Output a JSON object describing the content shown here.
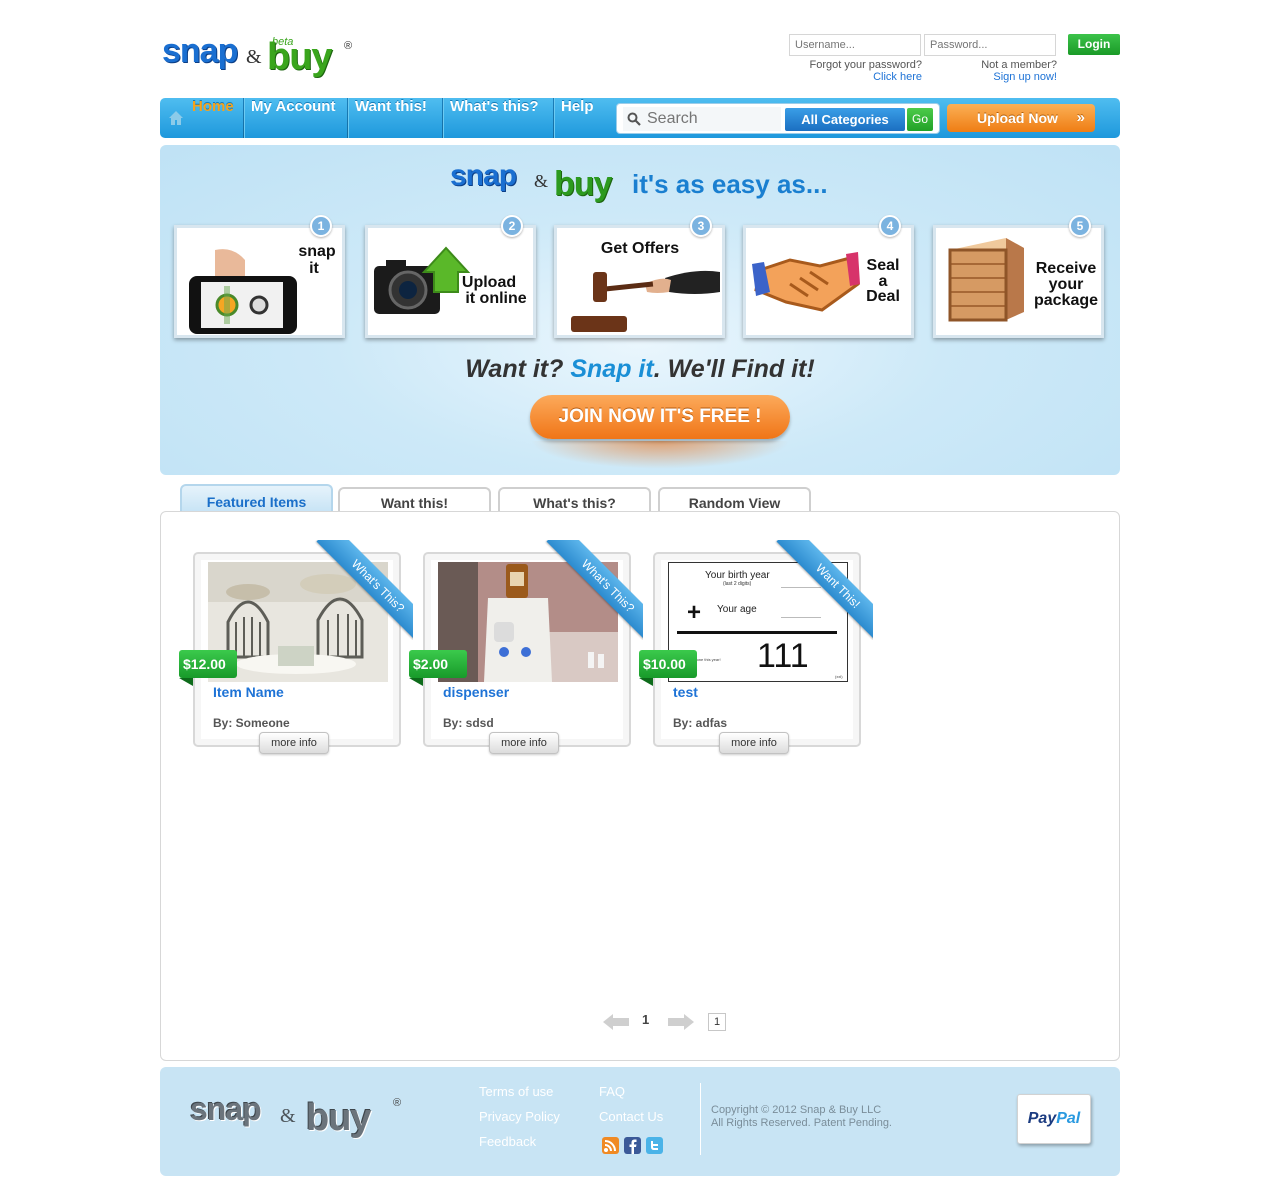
{
  "brand": {
    "snap": "snap",
    "amp": "&",
    "buy": "buy",
    "beta": "beta",
    "reg": "®"
  },
  "login": {
    "username_placeholder": "Username...",
    "password_placeholder": "Password...",
    "login_label": "Login",
    "forgot_text": "Forgot your password?",
    "forgot_link": "Click here",
    "member_text": "Not a member?",
    "member_link": "Sign up now!"
  },
  "nav": {
    "items": [
      {
        "label": "Home",
        "active": true
      },
      {
        "label": "My Account"
      },
      {
        "label": "Want this!"
      },
      {
        "label": "What's this?"
      },
      {
        "label": "Help"
      }
    ],
    "search_placeholder": "Search",
    "category_label": "All Categories",
    "go_label": "Go",
    "upload_label": "Upload Now",
    "upload_arrows": "»"
  },
  "banner": {
    "title_tag": "it's as easy as...",
    "steps": [
      {
        "num": "1",
        "label_line1": "snap",
        "label_line2": "it"
      },
      {
        "num": "2",
        "label_line1": "Upload",
        "label_line2": "it online"
      },
      {
        "num": "3",
        "label_line1": "Get Offers"
      },
      {
        "num": "4",
        "label_line1": "Seal",
        "label_line2": "a",
        "label_line3": "Deal"
      },
      {
        "num": "5",
        "label_line1": "Receive",
        "label_line2": "your",
        "label_line3": "package"
      }
    ],
    "tagline_a": "Want it? ",
    "tagline_b": "Snap it",
    "tagline_c": ". We'll Find it!",
    "join_label": "JOIN NOW IT'S FREE !"
  },
  "tabs": [
    {
      "label": "Featured Items",
      "active": true
    },
    {
      "label": "Want this!"
    },
    {
      "label": "What's this?"
    },
    {
      "label": "Random View"
    }
  ],
  "items": [
    {
      "price": "$12.00",
      "name": "Item Name",
      "by": "By: Someone",
      "ribbon": "What's This?",
      "more": "more info"
    },
    {
      "price": "$2.00",
      "name": "dispenser",
      "by": "By: sdsd",
      "ribbon": "What's This?",
      "more": "more info"
    },
    {
      "price": "$10.00",
      "name": "test",
      "by": "By: adfas",
      "ribbon": "Want This!",
      "more": "more info"
    }
  ],
  "item3_image": {
    "line1": "Your birth year",
    "line1_sub": "(last 2 digits)",
    "line2": "Your age",
    "plus": "+",
    "result": "111",
    "foot": "...me for everyone this year!",
    "foot_right": "(xxl)"
  },
  "pager": {
    "current": "1",
    "input_value": "1"
  },
  "footer": {
    "links_col1": [
      "Terms of use",
      "Privacy Policy",
      "Feedback"
    ],
    "links_col2": [
      "FAQ",
      "Contact Us"
    ],
    "copyright_line1": "Copyright © 2012 Snap & Buy LLC",
    "copyright_line2": "All Rights Reserved. Patent Pending.",
    "paypal_pay": "Pay",
    "paypal_pal": "Pal"
  },
  "colors": {
    "nav_blue": "#1e98dc",
    "accent_orange": "#f07517",
    "price_green": "#189a2a",
    "link_blue": "#1e73d6",
    "banner_bg": "#cde9f8"
  }
}
